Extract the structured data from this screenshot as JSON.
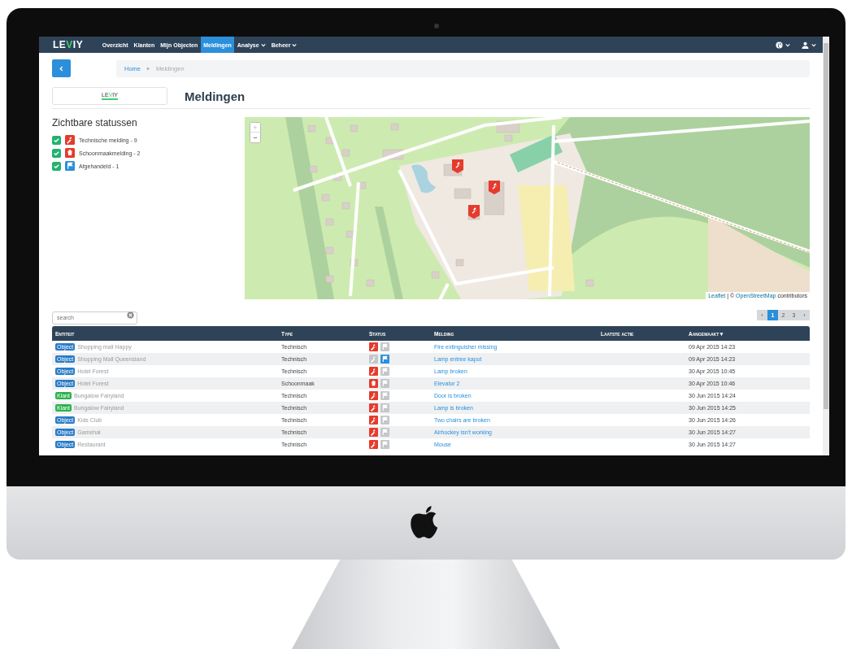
{
  "navbar": {
    "logo": [
      {
        "text": "LE",
        "accent": false
      },
      {
        "text": "V",
        "accent": true
      },
      {
        "text": "IY",
        "accent": false
      }
    ],
    "items": [
      {
        "label": "Overzicht",
        "selected": false,
        "dropdown": false
      },
      {
        "label": "Klanten",
        "selected": false,
        "dropdown": false
      },
      {
        "label": "Mijn Objecten",
        "selected": false,
        "dropdown": false
      },
      {
        "label": "Meldingen",
        "selected": true,
        "dropdown": false
      },
      {
        "label": "Analyse",
        "selected": false,
        "dropdown": true
      },
      {
        "label": "Beheer",
        "selected": false,
        "dropdown": true
      }
    ],
    "right_menus": [
      {
        "kind": "globe"
      },
      {
        "kind": "user"
      }
    ]
  },
  "breadcrumb": [
    {
      "label": "Home",
      "current": false
    },
    {
      "label": "Meldingen",
      "current": true
    }
  ],
  "brand_box": {
    "logo": [
      {
        "text": "LE",
        "accent": false
      },
      {
        "text": "V",
        "accent": true
      },
      {
        "text": "IY",
        "accent": false
      }
    ]
  },
  "heading": "Meldingen",
  "filters": {
    "title": "Zichtbare statussen",
    "items": [
      {
        "label": "Technische melding - 9",
        "checked": true,
        "kind": "wrench",
        "color": "#e53b2c"
      },
      {
        "label": "Schoonmaakmelding - 2",
        "checked": true,
        "kind": "cleaning",
        "color": "#e53b2c"
      },
      {
        "label": "Afgehandeld - 1",
        "checked": true,
        "kind": "flag",
        "color": "#2b8fdb"
      }
    ]
  },
  "map": {
    "zoom_in": "+",
    "zoom_out": "−",
    "attribution": {
      "first_link": "Leaflet",
      "separator": "| ©",
      "second_link": "OpenStreetMap",
      "suffix": "contributors"
    }
  },
  "search": {
    "placeholder": "search"
  },
  "pagination": [
    {
      "label": "‹",
      "selected": false
    },
    {
      "label": "1",
      "selected": true
    },
    {
      "label": "2",
      "selected": false
    },
    {
      "label": "3",
      "selected": false
    },
    {
      "label": "›",
      "selected": false
    }
  ],
  "table": {
    "columns": [
      {
        "label": "Entiteit"
      },
      {
        "label": "Type"
      },
      {
        "label": "Status"
      },
      {
        "label": "Melding"
      },
      {
        "label": "Laatste actie"
      },
      {
        "label": "Aangemaakt",
        "sort_icon": "▼"
      }
    ],
    "rows": [
      {
        "badge": {
          "text": "Object",
          "color": "#2a7cc7"
        },
        "entity": "Shopping mall Happy",
        "type": "Technisch",
        "status": {
          "kind": "wrench",
          "active": true,
          "resolved": false
        },
        "melding": "Fire extinguisher missing",
        "created": "09 Apr 2015 14:23"
      },
      {
        "badge": {
          "text": "Object",
          "color": "#2a7cc7"
        },
        "entity": "Shopping Mall Queensland",
        "type": "Technisch",
        "status": {
          "kind": "wrench",
          "active": false,
          "resolved": true
        },
        "melding": "Lamp entree kapot",
        "created": "09 Apr 2015 14:23"
      },
      {
        "badge": {
          "text": "Object",
          "color": "#2a7cc7"
        },
        "entity": "Hotel Forest",
        "type": "Technisch",
        "status": {
          "kind": "wrench",
          "active": true,
          "resolved": false
        },
        "melding": "Lamp broken",
        "created": "30 Apr 2015 10:45"
      },
      {
        "badge": {
          "text": "Object",
          "color": "#2a7cc7"
        },
        "entity": "Hotel Forest",
        "type": "Schoonmaak",
        "status": {
          "kind": "cleaning",
          "active": true,
          "resolved": false
        },
        "melding": "Elevator 2",
        "created": "30 Apr 2015 10:46"
      },
      {
        "badge": {
          "text": "Klant",
          "color": "#2bb24c"
        },
        "entity": "Bungalow Fairyland",
        "type": "Technisch",
        "status": {
          "kind": "wrench",
          "active": true,
          "resolved": false
        },
        "melding": "Door is broken",
        "created": "30 Jun 2015 14:24"
      },
      {
        "badge": {
          "text": "Klant",
          "color": "#2bb24c"
        },
        "entity": "Bungalow Fairyland",
        "type": "Technisch",
        "status": {
          "kind": "wrench",
          "active": true,
          "resolved": false
        },
        "melding": "Lamp is broken",
        "created": "30 Jun 2015 14:25"
      },
      {
        "badge": {
          "text": "Object",
          "color": "#2a7cc7"
        },
        "entity": "Kids Club",
        "type": "Technisch",
        "status": {
          "kind": "wrench",
          "active": true,
          "resolved": false
        },
        "melding": "Two chairs are broken",
        "created": "30 Jun 2015 14:26"
      },
      {
        "badge": {
          "text": "Object",
          "color": "#2a7cc7"
        },
        "entity": "Gamehal",
        "type": "Technisch",
        "status": {
          "kind": "wrench",
          "active": true,
          "resolved": false
        },
        "melding": "Airhockey isn't working",
        "created": "30 Jun 2015 14:27"
      },
      {
        "badge": {
          "text": "Object",
          "color": "#2a7cc7"
        },
        "entity": "Restaurant",
        "type": "Technisch",
        "status": {
          "kind": "wrench",
          "active": true,
          "resolved": false
        },
        "melding": "Mouse",
        "created": "30 Jun 2015 14:27"
      }
    ]
  }
}
